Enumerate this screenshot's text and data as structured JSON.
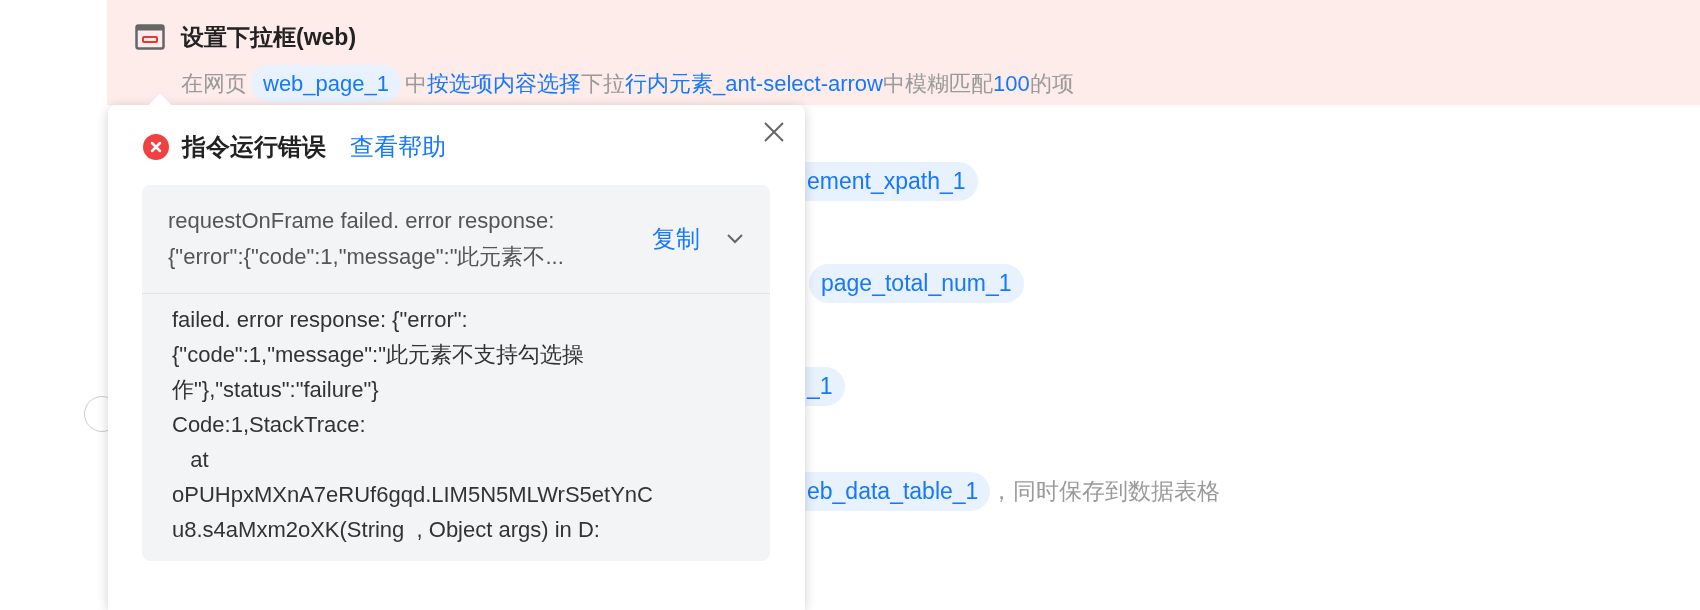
{
  "step": {
    "title": "设置下拉框(web)",
    "description": [
      {
        "kind": "text",
        "text": "在网页"
      },
      {
        "kind": "chip",
        "text": "web_page_1"
      },
      {
        "kind": "text",
        "text": "中"
      },
      {
        "kind": "link",
        "text": "按选项内容选择"
      },
      {
        "kind": "text",
        "text": "下拉"
      },
      {
        "kind": "link",
        "text": "行内元素_ant-select-arrow"
      },
      {
        "kind": "text",
        "text": "中模糊匹配"
      },
      {
        "kind": "link",
        "text": "100"
      },
      {
        "kind": "text",
        "text": "的项"
      }
    ]
  },
  "background_rows": [
    {
      "parts": [
        {
          "kind": "cut_chip",
          "text": "ement_xpath_1"
        }
      ]
    },
    {
      "parts": [
        {
          "kind": "chip",
          "text": "page_total_num_1"
        }
      ]
    },
    {
      "parts": [
        {
          "kind": "cut_chip",
          "text": "_1"
        }
      ]
    },
    {
      "parts": [
        {
          "kind": "cut_chip",
          "text": "eb_data_table_1"
        },
        {
          "kind": "text",
          "text": "，同时保存到数据表格"
        }
      ]
    }
  ],
  "error_popup": {
    "title": "指令运行错误",
    "help_link": "查看帮助",
    "summary": [
      "requestOnFrame failed. error response:",
      "{\"error\":{\"code\":1,\"message\":\"此元素不..."
    ],
    "copy_button": "复制",
    "expanded": true,
    "details": [
      "failed. error response: {\"error\":",
      "{\"code\":1,\"message\":\"此元素不支持勾选操",
      "作\"},\"status\":\"failure\"}",
      "Code:1,StackTrace:",
      "   at",
      "oPUHpxMXnA7eRUf6gqd.LIM5N5MLWrS5etYnC",
      "u8.s4aMxm2oXK(String  , Object args) in D:"
    ]
  }
}
